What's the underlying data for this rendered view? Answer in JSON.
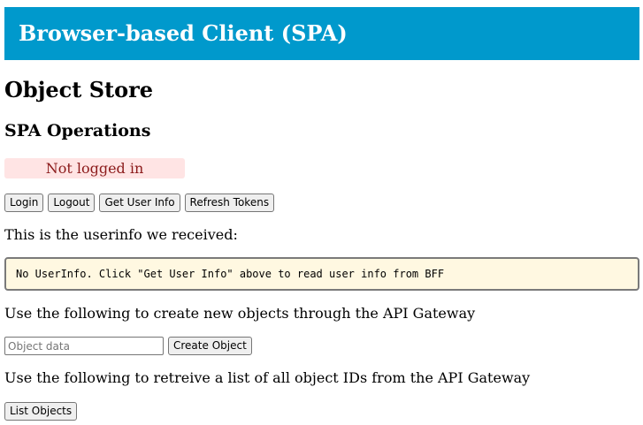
{
  "banner": {
    "title": "Browser-based Client (SPA)"
  },
  "page": {
    "title": "Object Store",
    "section_title": "SPA Operations"
  },
  "status": {
    "text": "Not logged in"
  },
  "auth_buttons": {
    "login": "Login",
    "logout": "Logout",
    "get_user_info": "Get User Info",
    "refresh_tokens": "Refresh Tokens"
  },
  "userinfo": {
    "intro": "This is the userinfo we received:",
    "content": "No UserInfo. Click \"Get User Info\" above to read user info from BFF"
  },
  "create": {
    "intro": "Use the following to create new objects through the API Gateway",
    "placeholder": "Object data",
    "value": "",
    "button": "Create Object"
  },
  "list": {
    "intro": "Use the following to retreive a list of all object IDs from the API Gateway",
    "button": "List Objects"
  },
  "colors": {
    "banner": "#0099cc",
    "status_bg": "#ffe4e4",
    "status_text": "#8b1a1a",
    "userinfo_bg": "#fff8e1"
  }
}
